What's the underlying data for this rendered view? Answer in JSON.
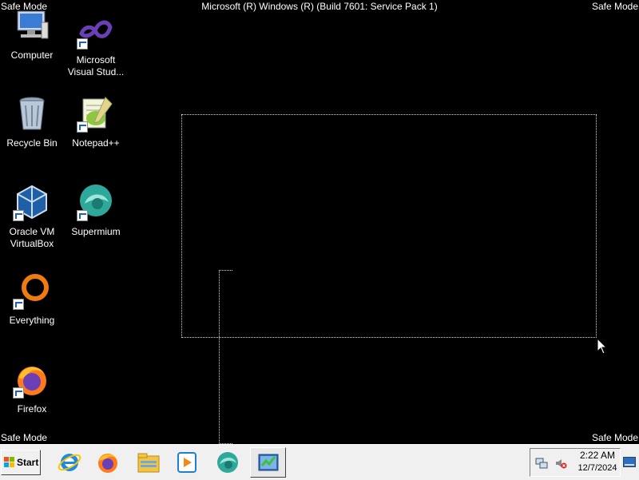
{
  "overlay": {
    "top_left": "Safe Mode",
    "top_right": "Safe Mode",
    "bottom_left": "Safe Mode",
    "bottom_right": "Safe Mode",
    "build": "Microsoft (R) Windows (R) (Build 7601: Service Pack 1)"
  },
  "desktop": {
    "icons": [
      {
        "label": "Computer",
        "icon": "computer-icon"
      },
      {
        "label": "Microsoft Visual Stud...",
        "icon": "visual-studio-icon"
      },
      {
        "label": "Recycle Bin",
        "icon": "recycle-bin-icon"
      },
      {
        "label": "Notepad++",
        "icon": "notepad-plus-plus-icon"
      },
      {
        "label": "Oracle VM VirtualBox",
        "icon": "virtualbox-icon"
      },
      {
        "label": "Supermium",
        "icon": "supermium-icon"
      },
      {
        "label": "Everything",
        "icon": "everything-icon"
      },
      {
        "label": "Firefox",
        "icon": "firefox-icon"
      }
    ]
  },
  "taskbar": {
    "start_label": "Start",
    "pinned": [
      "internet-explorer-icon",
      "firefox-icon",
      "file-explorer-icon",
      "media-player-icon",
      "supermium-icon",
      "task-manager-icon"
    ],
    "tray": [
      "network-icon",
      "volume-muted-icon"
    ],
    "clock_time": "2:22 AM",
    "clock_date": "12/7/2024"
  }
}
